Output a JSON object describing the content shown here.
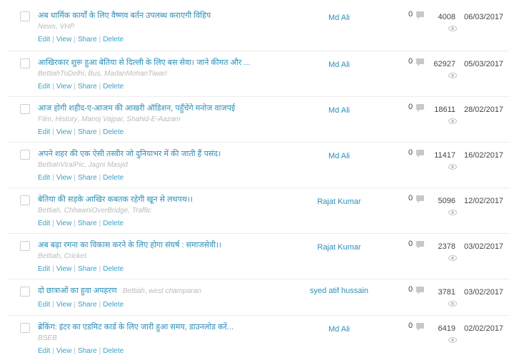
{
  "posts": [
    {
      "title": "अब धार्मिक कार्यों के लिए वैष्णव बर्तन उपलब्ध कराएगी विहिप",
      "tags": [
        "News",
        "VHP"
      ],
      "actions": [
        "Edit",
        "View",
        "Share",
        "Delete"
      ],
      "author": "Md Ali",
      "comments": "0",
      "views": "4008",
      "date": "06/03/2017"
    },
    {
      "title": "आखिरकार शुरू हुआ बेतिया से दिल्ली के लिए बस सेवा। जाने कीमत और ...",
      "tags": [
        "BettiahToDelhi",
        "Bus",
        "MadanMohanTiwari"
      ],
      "actions": [
        "Edit",
        "View",
        "Share",
        "Delete"
      ],
      "author": "Md Ali",
      "comments": "0",
      "views": "62927",
      "date": "05/03/2017"
    },
    {
      "title": "आज होगी शहीद-ए-आजम की आखरी ऑडिशन, पहुँचेंगे मनोज वाजपई",
      "tags": [
        "Film",
        "History",
        "Manoj Vajpai",
        "Shahid-E-Aazam"
      ],
      "actions": [
        "Edit",
        "View",
        "Share",
        "Delete"
      ],
      "author": "Md Ali",
      "comments": "0",
      "views": "18611",
      "date": "28/02/2017"
    },
    {
      "title": "अपने शहर की एक ऐसी तस्वीर जो दुनियाभर में की जाती हैं पसंद।",
      "tags": [
        "BettiahViralPic",
        "Jagni Masjid"
      ],
      "actions": [
        "Edit",
        "View",
        "Share",
        "Delete"
      ],
      "author": "Md Ali",
      "comments": "0",
      "views": "11417",
      "date": "16/02/2017"
    },
    {
      "title": "बेतिया की सड़के आखिर कबतक रहेगी खून से लथपथ।।",
      "tags": [
        "Bettiah",
        "ChhawniOverBridge",
        "Traffic"
      ],
      "actions": [
        "Edit",
        "View",
        "Share",
        "Delete"
      ],
      "author": "Rajat Kumar",
      "comments": "0",
      "views": "5096",
      "date": "12/02/2017"
    },
    {
      "title": "अब बढ़ा रमना का विकास करने के लिए होगा संघर्ष : समाजसेवी।।",
      "tags": [
        "Bettiah",
        "Cricket"
      ],
      "actions": [
        "Edit",
        "View",
        "Share",
        "Delete"
      ],
      "author": "Rajat Kumar",
      "comments": "0",
      "views": "2378",
      "date": "03/02/2017"
    },
    {
      "title": "दो छात्राओं का हुवा अपहरण",
      "tags": [
        "Bettiah",
        "west champaran"
      ],
      "actions": [
        "Edit",
        "View",
        "Share",
        "Delete"
      ],
      "author": "syed atif hussain",
      "comments": "0",
      "views": "3781",
      "date": "03/02/2017",
      "inline_tags": true
    },
    {
      "title": "ब्रेकिंग: इंटर का एडमिट कार्ड के लिए जारी हुआ समय, डाउनलोड करें...",
      "tags": [
        "BSEB"
      ],
      "actions": [
        "Edit",
        "View",
        "Share",
        "Delete"
      ],
      "author": "Md Ali",
      "comments": "0",
      "views": "6419",
      "date": "02/02/2017"
    }
  ]
}
